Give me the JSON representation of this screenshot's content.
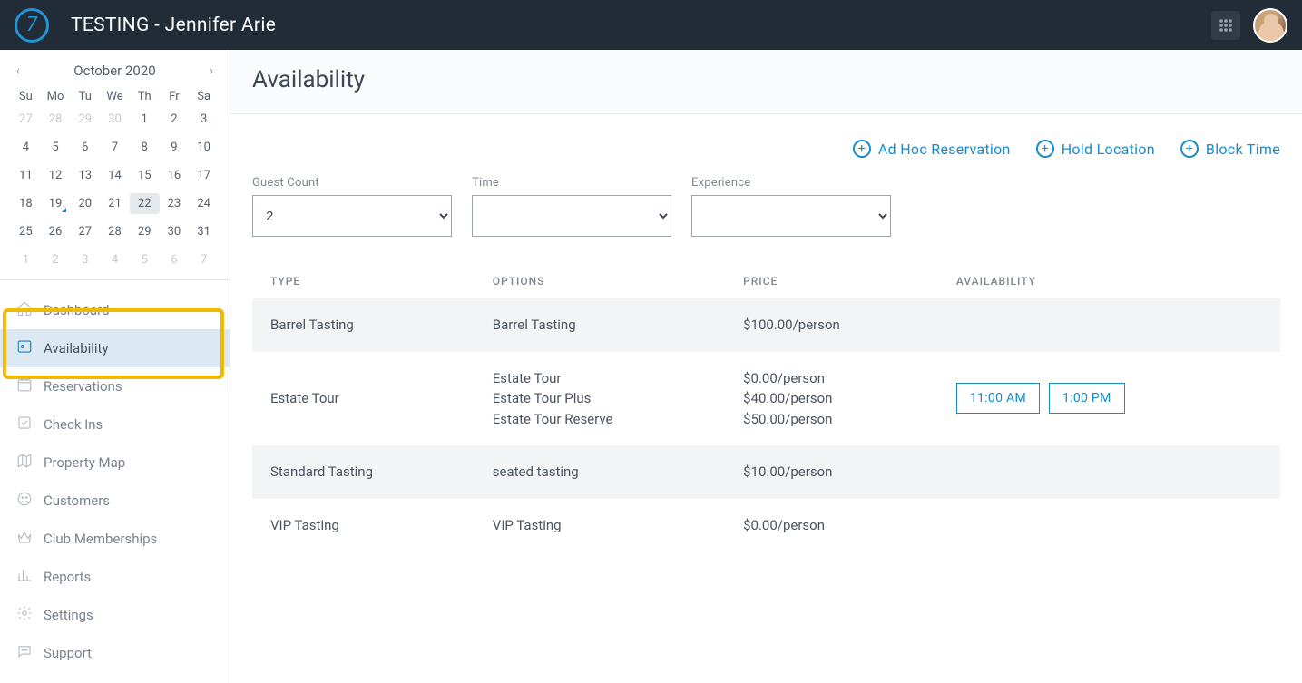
{
  "header": {
    "title": "TESTING - Jennifer Arie"
  },
  "calendar": {
    "month_label": "October 2020",
    "dow": [
      "Su",
      "Mo",
      "Tu",
      "We",
      "Th",
      "Fr",
      "Sa"
    ],
    "weeks": [
      [
        {
          "d": "27",
          "out": true
        },
        {
          "d": "28",
          "out": true
        },
        {
          "d": "29",
          "out": true
        },
        {
          "d": "30",
          "out": true
        },
        {
          "d": "1"
        },
        {
          "d": "2"
        },
        {
          "d": "3"
        }
      ],
      [
        {
          "d": "4"
        },
        {
          "d": "5"
        },
        {
          "d": "6"
        },
        {
          "d": "7"
        },
        {
          "d": "8"
        },
        {
          "d": "9"
        },
        {
          "d": "10"
        }
      ],
      [
        {
          "d": "11"
        },
        {
          "d": "12"
        },
        {
          "d": "13"
        },
        {
          "d": "14"
        },
        {
          "d": "15"
        },
        {
          "d": "16"
        },
        {
          "d": "17"
        }
      ],
      [
        {
          "d": "18"
        },
        {
          "d": "19",
          "today": true
        },
        {
          "d": "20"
        },
        {
          "d": "21"
        },
        {
          "d": "22",
          "selected": true
        },
        {
          "d": "23"
        },
        {
          "d": "24"
        }
      ],
      [
        {
          "d": "25"
        },
        {
          "d": "26"
        },
        {
          "d": "27"
        },
        {
          "d": "28"
        },
        {
          "d": "29"
        },
        {
          "d": "30"
        },
        {
          "d": "31"
        }
      ],
      [
        {
          "d": "1",
          "out": true
        },
        {
          "d": "2",
          "out": true
        },
        {
          "d": "3",
          "out": true
        },
        {
          "d": "4",
          "out": true
        },
        {
          "d": "5",
          "out": true
        },
        {
          "d": "6",
          "out": true
        },
        {
          "d": "7",
          "out": true
        }
      ]
    ]
  },
  "nav": {
    "items": [
      {
        "label": "Dashboard",
        "id": "dashboard"
      },
      {
        "label": "Availability",
        "id": "availability",
        "active": true
      },
      {
        "label": "Reservations",
        "id": "reservations"
      },
      {
        "label": "Check Ins",
        "id": "checkins"
      },
      {
        "label": "Property Map",
        "id": "propertymap"
      },
      {
        "label": "Customers",
        "id": "customers"
      },
      {
        "label": "Club Memberships",
        "id": "club"
      },
      {
        "label": "Reports",
        "id": "reports"
      },
      {
        "label": "Settings",
        "id": "settings"
      },
      {
        "label": "Support",
        "id": "support"
      }
    ]
  },
  "page": {
    "title": "Availability"
  },
  "actions": {
    "adhoc": "Ad Hoc Reservation",
    "hold": "Hold Location",
    "block": "Block Time"
  },
  "filters": {
    "guest_count_label": "Guest Count",
    "guest_count_value": "2",
    "time_label": "Time",
    "experience_label": "Experience"
  },
  "table": {
    "headers": [
      "TYPE",
      "OPTIONS",
      "PRICE",
      "AVAILABILITY"
    ],
    "rows": [
      {
        "type": "Barrel Tasting",
        "options": [
          "Barrel Tasting"
        ],
        "prices": [
          "$100.00/person"
        ],
        "slots": [],
        "striped": true
      },
      {
        "type": "Estate Tour",
        "options": [
          "Estate Tour",
          "Estate Tour Plus",
          "Estate Tour Reserve"
        ],
        "prices": [
          "$0.00/person",
          "$40.00/person",
          "$50.00/person"
        ],
        "slots": [
          "11:00 AM",
          "1:00 PM"
        ],
        "striped": false
      },
      {
        "type": "Standard Tasting",
        "options": [
          "seated tasting"
        ],
        "prices": [
          "$10.00/person"
        ],
        "slots": [],
        "striped": true
      },
      {
        "type": "VIP Tasting",
        "options": [
          "VIP Tasting"
        ],
        "prices": [
          "$0.00/person"
        ],
        "slots": [],
        "striped": false
      }
    ]
  }
}
